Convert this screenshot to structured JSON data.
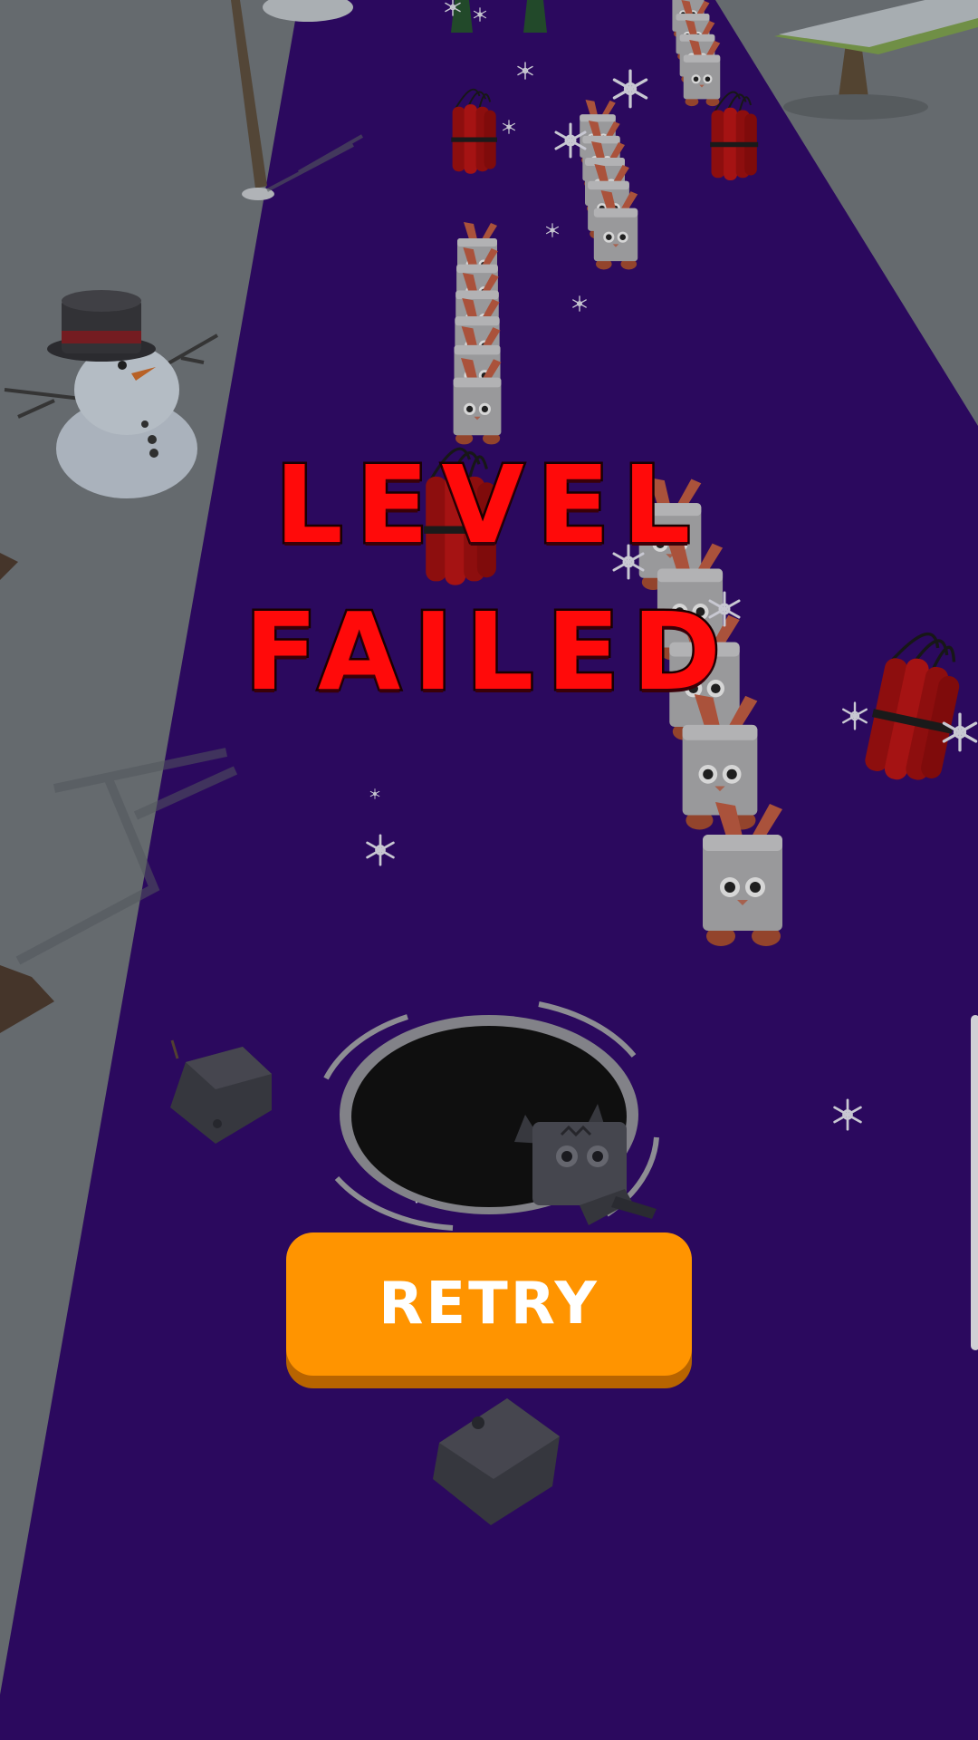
{
  "screen": {
    "title_line1": "LEVEL",
    "title_line2": "FAILED",
    "retry_label": "RETRY"
  },
  "colors": {
    "track": "#2f0a66",
    "ground": "#6e7378",
    "title_fill": "#ff0a0a",
    "button": "#ff9400",
    "button_shadow": "#b86400"
  },
  "icons": {
    "hole": "black-hole",
    "enemies": "bunny-cube",
    "bombs": "dynamite-bundle",
    "decor": [
      "snowman",
      "pine-tree",
      "bare-tree",
      "snowflake"
    ]
  }
}
